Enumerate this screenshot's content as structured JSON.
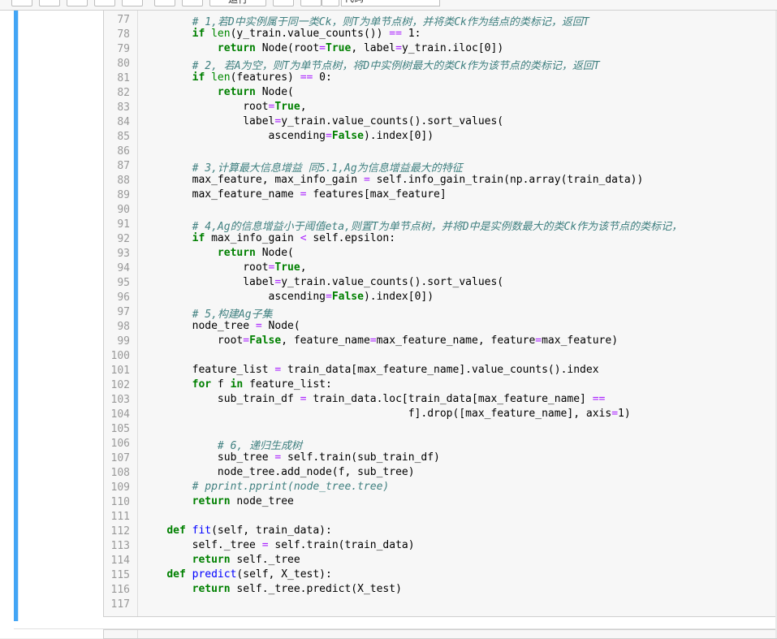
{
  "toolbar": {
    "run_label": "运行",
    "cell_type_value": "代码"
  },
  "editor": {
    "lines": [
      {
        "n": "77",
        "t": [
          [
            "c",
            "        # 1,若D中实例属于同一类Ck，则T为单节点树，并将类Ck作为结点的类标记，返回T"
          ]
        ]
      },
      {
        "n": "78",
        "t": [
          [
            "",
            "        "
          ],
          [
            "k",
            "if"
          ],
          [
            "",
            " "
          ],
          [
            "n",
            "len"
          ],
          [
            "",
            "(y_train.value_counts()) "
          ],
          [
            "o",
            "=="
          ],
          [
            "",
            " 1:"
          ]
        ]
      },
      {
        "n": "79",
        "t": [
          [
            "",
            "            "
          ],
          [
            "k",
            "return"
          ],
          [
            "",
            " Node(root"
          ],
          [
            "o",
            "="
          ],
          [
            "k",
            "True"
          ],
          [
            "",
            ", label"
          ],
          [
            "o",
            "="
          ],
          [
            "",
            "y_train.iloc[0])"
          ]
        ]
      },
      {
        "n": "80",
        "t": [
          [
            "c",
            "        # 2, 若A为空，则T为单节点树，将D中实例树最大的类Ck作为该节点的类标记，返回T"
          ]
        ]
      },
      {
        "n": "81",
        "t": [
          [
            "",
            "        "
          ],
          [
            "k",
            "if"
          ],
          [
            "",
            " "
          ],
          [
            "n",
            "len"
          ],
          [
            "",
            "(features) "
          ],
          [
            "o",
            "=="
          ],
          [
            "",
            " 0:"
          ]
        ]
      },
      {
        "n": "82",
        "t": [
          [
            "",
            "            "
          ],
          [
            "k",
            "return"
          ],
          [
            "",
            " Node("
          ]
        ]
      },
      {
        "n": "83",
        "t": [
          [
            "",
            "                root"
          ],
          [
            "o",
            "="
          ],
          [
            "k",
            "True"
          ],
          [
            "",
            ","
          ]
        ]
      },
      {
        "n": "84",
        "t": [
          [
            "",
            "                label"
          ],
          [
            "o",
            "="
          ],
          [
            "",
            "y_train.value_counts().sort_values("
          ]
        ]
      },
      {
        "n": "85",
        "t": [
          [
            "",
            "                    ascending"
          ],
          [
            "o",
            "="
          ],
          [
            "k",
            "False"
          ],
          [
            "",
            ").index[0])"
          ]
        ]
      },
      {
        "n": "86",
        "t": [
          [
            "",
            ""
          ]
        ]
      },
      {
        "n": "87",
        "t": [
          [
            "c",
            "        # 3,计算最大信息增益 同5.1,Ag为信息增益最大的特征"
          ]
        ]
      },
      {
        "n": "88",
        "t": [
          [
            "",
            "        max_feature, max_info_gain "
          ],
          [
            "o",
            "="
          ],
          [
            "",
            " self.info_gain_train(np.array(train_data))"
          ]
        ]
      },
      {
        "n": "89",
        "t": [
          [
            "",
            "        max_feature_name "
          ],
          [
            "o",
            "="
          ],
          [
            "",
            " features[max_feature]"
          ]
        ]
      },
      {
        "n": "90",
        "t": [
          [
            "",
            ""
          ]
        ]
      },
      {
        "n": "91",
        "t": [
          [
            "c",
            "        # 4,Ag的信息增益小于阈值eta,则置T为单节点树，并将D中是实例数最大的类Ck作为该节点的类标记，"
          ]
        ]
      },
      {
        "n": "92",
        "t": [
          [
            "",
            "        "
          ],
          [
            "k",
            "if"
          ],
          [
            "",
            " max_info_gain "
          ],
          [
            "o",
            "<"
          ],
          [
            "",
            " self.epsilon:"
          ]
        ]
      },
      {
        "n": "93",
        "t": [
          [
            "",
            "            "
          ],
          [
            "k",
            "return"
          ],
          [
            "",
            " Node("
          ]
        ]
      },
      {
        "n": "94",
        "t": [
          [
            "",
            "                root"
          ],
          [
            "o",
            "="
          ],
          [
            "k",
            "True"
          ],
          [
            "",
            ","
          ]
        ]
      },
      {
        "n": "95",
        "t": [
          [
            "",
            "                label"
          ],
          [
            "o",
            "="
          ],
          [
            "",
            "y_train.value_counts().sort_values("
          ]
        ]
      },
      {
        "n": "96",
        "t": [
          [
            "",
            "                    ascending"
          ],
          [
            "o",
            "="
          ],
          [
            "k",
            "False"
          ],
          [
            "",
            ").index[0])"
          ]
        ]
      },
      {
        "n": "97",
        "t": [
          [
            "c",
            "        # 5,构建Ag子集"
          ]
        ]
      },
      {
        "n": "98",
        "t": [
          [
            "",
            "        node_tree "
          ],
          [
            "o",
            "="
          ],
          [
            "",
            " Node("
          ]
        ]
      },
      {
        "n": "99",
        "t": [
          [
            "",
            "            root"
          ],
          [
            "o",
            "="
          ],
          [
            "k",
            "False"
          ],
          [
            "",
            ", feature_name"
          ],
          [
            "o",
            "="
          ],
          [
            "",
            "max_feature_name, feature"
          ],
          [
            "o",
            "="
          ],
          [
            "",
            "max_feature)"
          ]
        ]
      },
      {
        "n": "100",
        "t": [
          [
            "",
            ""
          ]
        ]
      },
      {
        "n": "101",
        "t": [
          [
            "",
            "        feature_list "
          ],
          [
            "o",
            "="
          ],
          [
            "",
            " train_data[max_feature_name].value_counts().index"
          ]
        ]
      },
      {
        "n": "102",
        "t": [
          [
            "",
            "        "
          ],
          [
            "k",
            "for"
          ],
          [
            "",
            " f "
          ],
          [
            "k",
            "in"
          ],
          [
            "",
            " feature_list:"
          ]
        ]
      },
      {
        "n": "103",
        "t": [
          [
            "",
            "            sub_train_df "
          ],
          [
            "o",
            "="
          ],
          [
            "",
            " train_data.loc[train_data[max_feature_name] "
          ],
          [
            "o",
            "=="
          ]
        ]
      },
      {
        "n": "104",
        "t": [
          [
            "",
            "                                          f].drop([max_feature_name], axis"
          ],
          [
            "o",
            "="
          ],
          [
            "",
            "1)"
          ]
        ]
      },
      {
        "n": "105",
        "t": [
          [
            "",
            ""
          ]
        ]
      },
      {
        "n": "106",
        "t": [
          [
            "c",
            "            # 6, 递归生成树"
          ]
        ]
      },
      {
        "n": "107",
        "t": [
          [
            "",
            "            sub_tree "
          ],
          [
            "o",
            "="
          ],
          [
            "",
            " self.train(sub_train_df)"
          ]
        ]
      },
      {
        "n": "108",
        "t": [
          [
            "",
            "            node_tree.add_node(f, sub_tree)"
          ]
        ]
      },
      {
        "n": "109",
        "t": [
          [
            "c",
            "        # pprint.pprint(node_tree.tree)"
          ]
        ]
      },
      {
        "n": "110",
        "t": [
          [
            "",
            "        "
          ],
          [
            "k",
            "return"
          ],
          [
            "",
            " node_tree"
          ]
        ]
      },
      {
        "n": "111",
        "t": [
          [
            "",
            ""
          ]
        ]
      },
      {
        "n": "112",
        "t": [
          [
            "",
            "    "
          ],
          [
            "k",
            "def"
          ],
          [
            "",
            " "
          ],
          [
            "f",
            "fit"
          ],
          [
            "",
            "(self, train_data):"
          ]
        ]
      },
      {
        "n": "113",
        "t": [
          [
            "",
            "        self._tree "
          ],
          [
            "o",
            "="
          ],
          [
            "",
            " self.train(train_data)"
          ]
        ]
      },
      {
        "n": "114",
        "t": [
          [
            "",
            "        "
          ],
          [
            "k",
            "return"
          ],
          [
            "",
            " self._tree"
          ]
        ]
      },
      {
        "n": "115",
        "t": [
          [
            "",
            "    "
          ],
          [
            "k",
            "def"
          ],
          [
            "",
            " "
          ],
          [
            "f",
            "predict"
          ],
          [
            "",
            "(self, X_test):"
          ]
        ]
      },
      {
        "n": "116",
        "t": [
          [
            "",
            "        "
          ],
          [
            "k",
            "return"
          ],
          [
            "",
            " self._tree.predict(X_test)"
          ]
        ]
      },
      {
        "n": "117",
        "t": [
          [
            "",
            ""
          ]
        ]
      }
    ]
  }
}
